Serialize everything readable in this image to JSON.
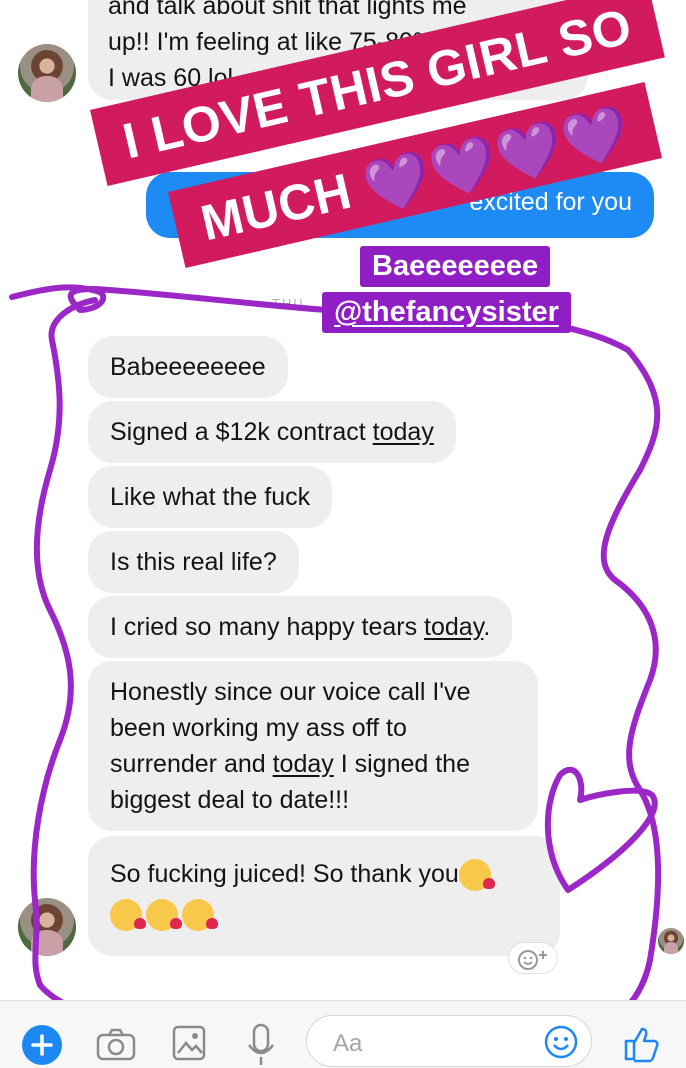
{
  "top_message": {
    "line1": "and talk about shit that lights me",
    "line2": "up!! I'm feeling at like 75-80% earlier",
    "line3": "I was 60 lol"
  },
  "sent_message": {
    "text": "excited for you"
  },
  "overlay": {
    "sticker_line1": "I LOVE THIS GIRL SO",
    "sticker_line2": "MUCH",
    "hearts": "💜💜💜💜",
    "tag_line1": "Baeeeeeeee",
    "tag_line2": "@thefancysister",
    "timestamp_fragment": "THU"
  },
  "messages": [
    {
      "pre": "Babeeeeeeee",
      "u": "",
      "post": ""
    },
    {
      "pre": "Signed a $12k contract ",
      "u": "today",
      "post": ""
    },
    {
      "pre": "Like what the fuck",
      "u": "",
      "post": ""
    },
    {
      "pre": "Is this real life?",
      "u": "",
      "post": ""
    },
    {
      "pre": "I cried so many happy tears ",
      "u": "today",
      "post": "."
    },
    {
      "l1": "Honestly since our voice call I've",
      "l2": "been working my ass off to",
      "l3a": "surrender and ",
      "l3u": "today",
      "l3b": " I signed the",
      "l4": "biggest deal to date!!!"
    },
    {
      "text": "So fucking juiced! So thank you"
    }
  ],
  "composer": {
    "placeholder": "Aa"
  },
  "icons": [
    "plus-icon",
    "camera-icon",
    "image-icon",
    "microphone-icon",
    "emoji-icon",
    "thumbs-up-icon",
    "add-reaction-icon"
  ],
  "colors": {
    "sent_bubble": "#1e8bf5",
    "received_bubble": "#eeeeee",
    "sticker": "#d21a5e",
    "tag": "#8f1fc4",
    "scribble": "#9b27c7"
  }
}
